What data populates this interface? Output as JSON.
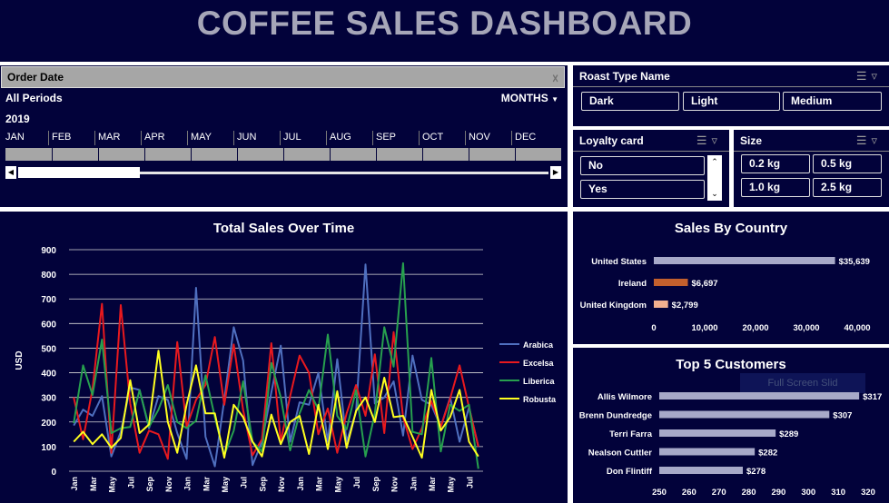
{
  "dashboard": {
    "title": "COFFEE SALES DASHBOARD"
  },
  "timeline": {
    "header": "Order Date",
    "periods_label": "All Periods",
    "level_label": "MONTHS",
    "year": "2019",
    "months": [
      "JAN",
      "FEB",
      "MAR",
      "APR",
      "MAY",
      "JUN",
      "JUL",
      "AUG",
      "SEP",
      "OCT",
      "NOV",
      "DEC"
    ],
    "selection_fraction": 0.23
  },
  "roast_slicer": {
    "title": "Roast Type Name",
    "items": [
      "Dark",
      "Light",
      "Medium"
    ]
  },
  "loyalty_slicer": {
    "title": "Loyalty card",
    "items": [
      "No",
      "Yes"
    ]
  },
  "size_slicer": {
    "title": "Size",
    "items": [
      "0.2 kg",
      "0.5 kg",
      "1.0 kg",
      "2.5 kg"
    ]
  },
  "colors": {
    "background": "#02023a",
    "arabica": "#4f6fbf",
    "excelsa": "#e8191e",
    "liberica": "#27a04e",
    "robusta": "#ffff1f",
    "country_us": "#a7a9c8",
    "country_ie": "#c3602d",
    "country_uk": "#f2b08f",
    "customer_bar": "#a7a9c8"
  },
  "chart_data": [
    {
      "type": "line",
      "title": "Total Sales Over Time",
      "ylabel": "USD",
      "xlabel": "",
      "ylim": [
        0,
        900
      ],
      "yticks": [
        0,
        100,
        200,
        300,
        400,
        500,
        600,
        700,
        800,
        900
      ],
      "legend_position": "right",
      "grid": true,
      "x": [
        "Jan",
        "Feb",
        "Mar",
        "Apr",
        "May",
        "Jun",
        "Jul",
        "Aug",
        "Sep",
        "Oct",
        "Nov",
        "Dec",
        "Jan",
        "Feb",
        "Mar",
        "Apr",
        "May",
        "Jun",
        "Jul",
        "Aug",
        "Sep",
        "Oct",
        "Nov",
        "Dec",
        "Jan",
        "Feb",
        "Mar",
        "Apr",
        "May",
        "Jun",
        "Jul",
        "Aug",
        "Sep",
        "Oct",
        "Nov",
        "Dec",
        "Jan",
        "Feb",
        "Mar",
        "Apr",
        "May",
        "Jun",
        "Jul",
        "Aug"
      ],
      "x_tick_labels": [
        "Jan",
        "Mar",
        "May",
        "Jul",
        "Sep",
        "Nov",
        "Jan",
        "Mar",
        "May",
        "Jul",
        "Sep",
        "Nov",
        "Jan",
        "Mar",
        "May",
        "Jul",
        "Sep",
        "Nov",
        "Jan",
        "Mar",
        "May",
        "Jul"
      ],
      "series": [
        {
          "name": "Arabica",
          "values": [
            186,
            250,
            225,
            305,
            60,
            160,
            340,
            330,
            175,
            305,
            290,
            155,
            50,
            745,
            140,
            20,
            290,
            585,
            450,
            25,
            120,
            320,
            510,
            120,
            280,
            270,
            400,
            120,
            455,
            120,
            240,
            840,
            275,
            300,
            365,
            145,
            470,
            290,
            270,
            180,
            300,
            120,
            260,
            100
          ]
        },
        {
          "name": "Excelsa",
          "values": [
            300,
            130,
            335,
            680,
            75,
            675,
            275,
            75,
            165,
            150,
            50,
            525,
            180,
            290,
            350,
            545,
            270,
            515,
            250,
            65,
            130,
            520,
            120,
            305,
            470,
            400,
            150,
            255,
            75,
            235,
            350,
            225,
            475,
            155,
            565,
            220,
            90,
            175,
            285,
            180,
            295,
            430,
            260,
            100
          ]
        },
        {
          "name": "Liberica",
          "values": [
            195,
            430,
            310,
            535,
            155,
            175,
            180,
            330,
            180,
            250,
            350,
            200,
            175,
            205,
            390,
            220,
            65,
            165,
            365,
            120,
            80,
            440,
            300,
            85,
            235,
            330,
            250,
            555,
            225,
            170,
            330,
            60,
            235,
            585,
            425,
            845,
            160,
            150,
            460,
            80,
            270,
            245,
            270,
            10
          ]
        },
        {
          "name": "Robusta",
          "values": [
            120,
            160,
            110,
            150,
            95,
            135,
            370,
            155,
            190,
            490,
            200,
            75,
            270,
            430,
            235,
            235,
            55,
            270,
            220,
            120,
            60,
            230,
            110,
            200,
            225,
            70,
            270,
            90,
            325,
            95,
            245,
            300,
            200,
            380,
            220,
            225,
            140,
            55,
            330,
            165,
            220,
            330,
            120,
            60
          ]
        }
      ]
    },
    {
      "type": "bar",
      "title": "Sales By Country",
      "categories": [
        "United States",
        "Ireland",
        "United Kingdom"
      ],
      "values": [
        35639,
        6697,
        2799
      ],
      "data_labels": [
        "$35,639",
        "$6,697",
        "$2,799"
      ],
      "xlim": [
        0,
        40000
      ],
      "xticks": [
        "0",
        "10,000",
        "20,000",
        "30,000",
        "40,000"
      ]
    },
    {
      "type": "bar",
      "title": "Top 5 Customers",
      "categories": [
        "Allis Wilmore",
        "Brenn Dundredge",
        "Terri Farra",
        "Nealson Cuttler",
        "Don Flintiff"
      ],
      "values": [
        317,
        307,
        289,
        282,
        278
      ],
      "data_labels": [
        "$317",
        "$307",
        "$289",
        "$282",
        "$278"
      ],
      "xlim": [
        250,
        320
      ],
      "xticks": [
        "250",
        "260",
        "270",
        "280",
        "290",
        "300",
        "310",
        "320"
      ]
    }
  ],
  "overlay": {
    "ghost_text": "Full Screen Slid"
  }
}
